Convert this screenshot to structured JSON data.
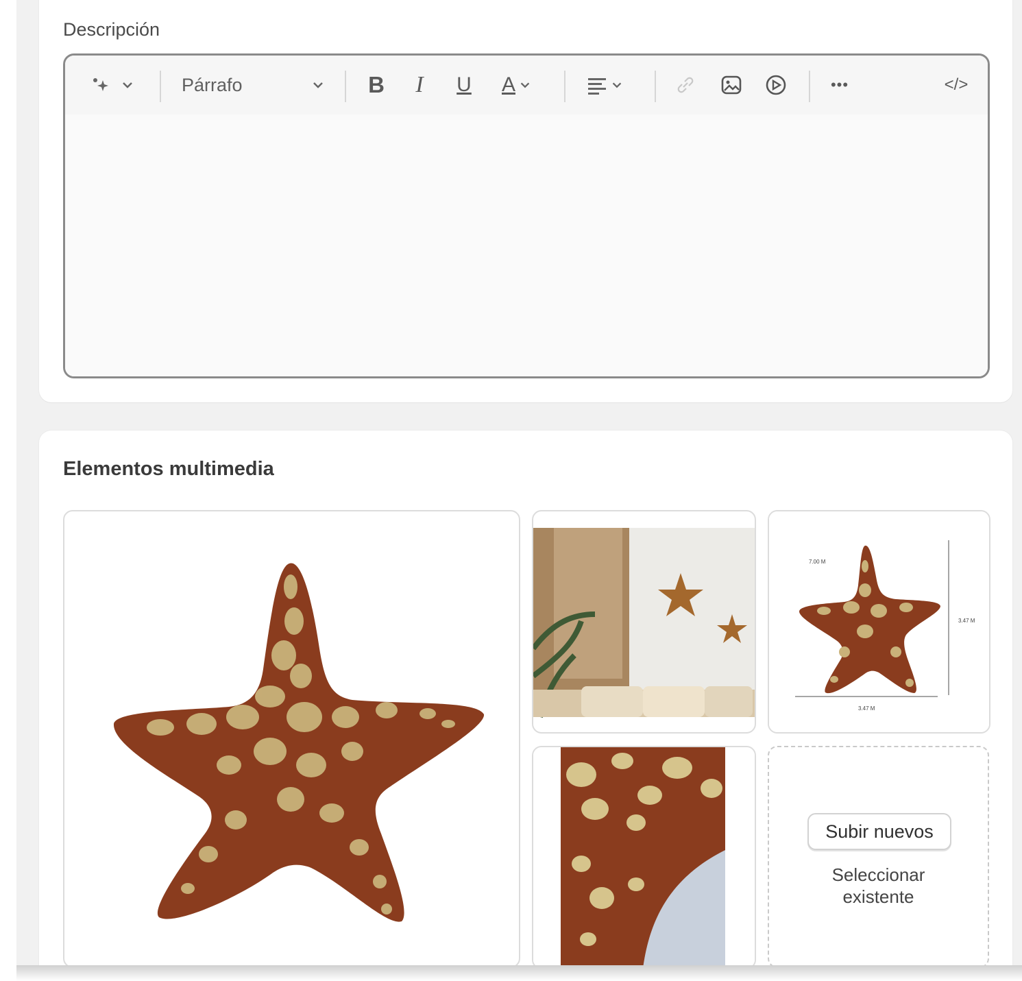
{
  "description": {
    "label": "Descripción",
    "toolbar": {
      "ai_icon": "sparkle-icon",
      "paragraph_label": "Párrafo",
      "bold_label": "B",
      "italic_label": "I",
      "underline_label": "U",
      "color_label": "A",
      "more_label": "•••",
      "code_label": "</>"
    },
    "content": ""
  },
  "media": {
    "title": "Elementos multimedia",
    "upload_button": "Subir nuevos",
    "select_existing": "Seleccionar existente",
    "dimension_labels": [
      "7.00 M",
      "3.47 M",
      "3.47 M"
    ]
  },
  "colors": {
    "star_brown": "#8a3c1e",
    "star_fiber": "#c9b27a",
    "border": "#8a8a8a"
  }
}
